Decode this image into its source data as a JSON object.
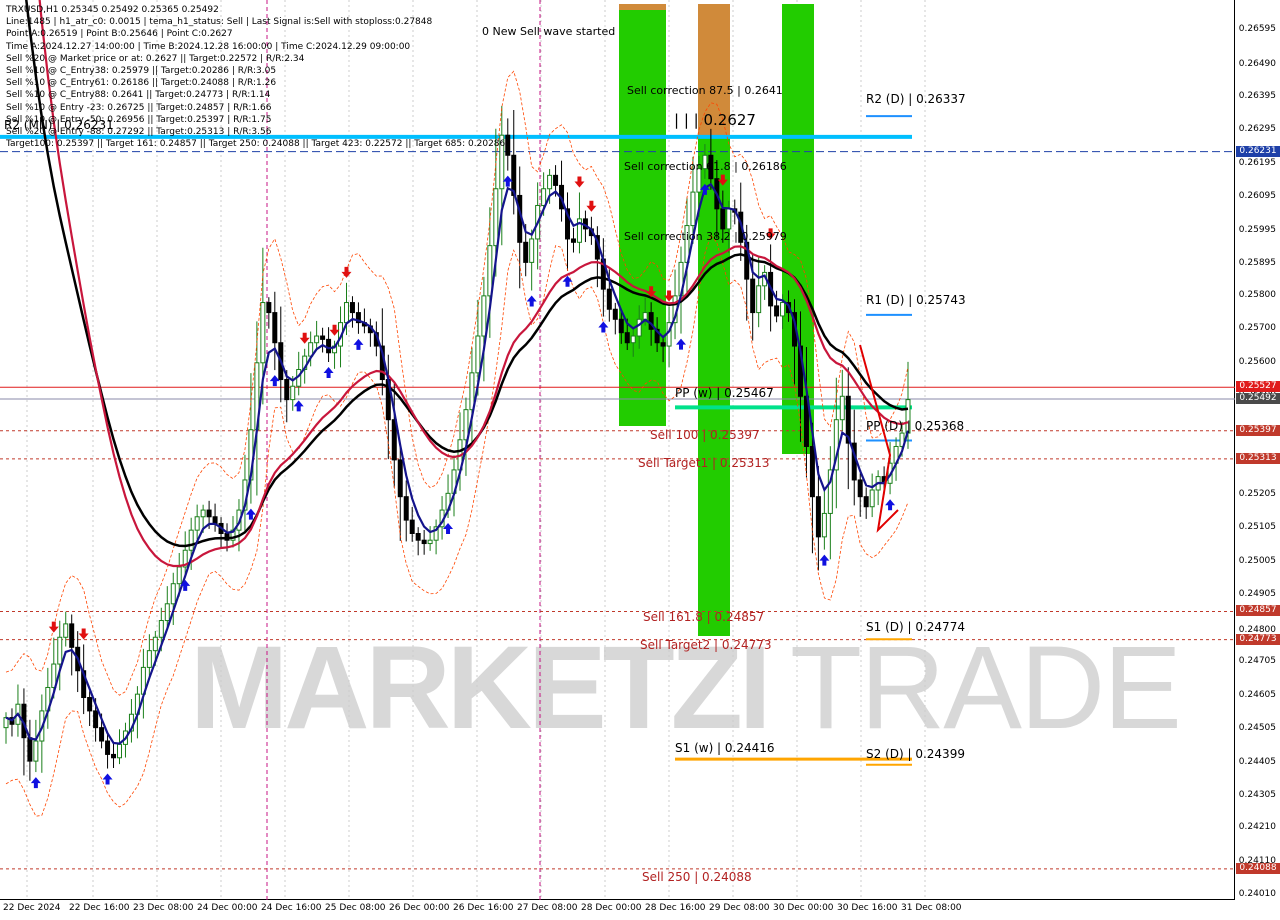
{
  "info_lines": [
    "TRXUSD,H1  0.25345 0.25492 0.25365 0.25492",
    "Line:1485 | h1_atr_c0: 0.0015 | tema_h1_status: Sell | Last Signal is:Sell with stoploss:0.27848",
    "Point A:0.26519 | Point B:0.25646 | Point C:0.2627",
    "Time A:2024.12.27 14:00:00 | Time B:2024.12.28 16:00:00 | Time C:2024.12.29 09:00:00",
    "Sell %20 @ Market price or at: 0.2627 || Target:0.22572 | R/R:2.34",
    "Sell %10 @ C_Entry38: 0.25979 || Target:0.20286 | R/R:3.05",
    "Sell %10 @ C_Entry61: 0.26186 || Target:0.24088 | R/R:1.26",
    "Sell %10 @ C_Entry88: 0.2641 || Target:0.24773 | R/R:1.14",
    "Sell %10 @ Entry -23: 0.26725 || Target:0.24857 | R/R:1.66",
    "Sell %10 @ Entry -50: 0.26956 || Target:0.25397 | R/R:1.75",
    "Sell %20 @ Entry -88: 0.27292 || Target:0.25313 | R/R:3.56",
    "Target100: 0.25397 || Target 161: 0.24857 || Target 250: 0.24088 || Target 423: 0.22572 || Target 685: 0.20286"
  ],
  "watermark": {
    "left": "MARKETZI",
    "right": "TRADE"
  },
  "signal_text": "0 New Sell wave started",
  "point_c_label": "| | | 0.2627",
  "r2_mn_label": "R2 (MN) | 0.26231",
  "level_labels": {
    "r2": "R2 (D) | 0.26337",
    "r1": "R1 (D) | 0.25743",
    "pp_w": "PP (w) | 0.25467",
    "pp_d": "PP (D) | 0.25368",
    "s1_d": "S1 (D) | 0.24774",
    "s1_w": "S1 (w) | 0.24416",
    "s2_d": "S2 (D) | 0.24399",
    "sell_100": "Sell 100 | 0.25397",
    "sell_target1": "Sell Target1 | 0.25313",
    "sell_161": "Sell 161.8 | 0.24857",
    "sell_target2": "Sell Target2 | 0.24773",
    "sell_250": "Sell 250 | 0.24088",
    "corr_875": "Sell correction 87.5 | 0.2641",
    "corr_618": "Sell correction 61.8 | 0.26186",
    "corr_382": "Sell correction 38.2 | 0.25979"
  },
  "price_badges": [
    {
      "text": "0.26231",
      "color": "#1e40a8",
      "price": 0.26231
    },
    {
      "text": "0.25527",
      "color": "#e01b1b",
      "price": 0.25527
    },
    {
      "text": "0.25492",
      "color": "#4a4a4a",
      "price": 0.25492
    },
    {
      "text": "0.25397",
      "color": "#c0392b",
      "price": 0.25397
    },
    {
      "text": "0.25313",
      "color": "#c0392b",
      "price": 0.25313
    },
    {
      "text": "0.24857",
      "color": "#c0392b",
      "price": 0.24857
    },
    {
      "text": "0.24773",
      "color": "#c0392b",
      "price": 0.24773
    },
    {
      "text": "0.24088",
      "color": "#c0392b",
      "price": 0.24088
    }
  ],
  "colors": {
    "bull": "#1a7f1a",
    "bear": "#000000",
    "tema": "#14148c",
    "sma200": "#000000",
    "sma_red": "#c8163c",
    "envelope": "#ff4500",
    "green_zone": "#22cc00",
    "orange_zone": "#d08a3a",
    "cyan_line": "#00bfff",
    "pp_w_line": "#00e28a",
    "s_orange": "#ffa500",
    "r_level": "#1e90ff"
  },
  "chart_data": {
    "type": "candlestick",
    "symbol": "TRXUSD",
    "timeframe": "H1",
    "ohlc_last": {
      "open": 0.25345,
      "high": 0.25492,
      "low": 0.25365,
      "close": 0.25492
    },
    "ylim": [
      0.2401,
      0.2666
    ],
    "y_ticks": [
      "0.26595",
      "0.26490",
      "0.26395",
      "0.26295",
      "0.26195",
      "0.26095",
      "0.25995",
      "0.25895",
      "0.25800",
      "0.25700",
      "0.25600",
      "0.25500",
      "0.25395",
      "0.25300",
      "0.25205",
      "0.25105",
      "0.25005",
      "0.24905",
      "0.24800",
      "0.24705",
      "0.24605",
      "0.24505",
      "0.24405",
      "0.24305",
      "0.24210",
      "0.24110",
      "0.24010"
    ],
    "x_ticks": [
      "22 Dec 2024",
      "22 Dec 16:00",
      "23 Dec 08:00",
      "24 Dec 00:00",
      "24 Dec 16:00",
      "25 Dec 08:00",
      "26 Dec 00:00",
      "26 Dec 16:00",
      "27 Dec 08:00",
      "28 Dec 00:00",
      "28 Dec 16:00",
      "29 Dec 08:00",
      "30 Dec 00:00",
      "30 Dec 16:00",
      "31 Dec 08:00"
    ],
    "closes": [
      0.2454,
      0.2452,
      0.2458,
      0.2448,
      0.2441,
      0.2447,
      0.2456,
      0.2463,
      0.247,
      0.2478,
      0.2482,
      0.2475,
      0.2468,
      0.246,
      0.2456,
      0.2451,
      0.2447,
      0.2443,
      0.2442,
      0.2446,
      0.245,
      0.2455,
      0.2461,
      0.2469,
      0.2474,
      0.2478,
      0.2483,
      0.2488,
      0.2494,
      0.2499,
      0.2504,
      0.251,
      0.2514,
      0.2516,
      0.2514,
      0.2512,
      0.2509,
      0.2507,
      0.251,
      0.2516,
      0.2525,
      0.254,
      0.256,
      0.2578,
      0.2575,
      0.2566,
      0.2555,
      0.2549,
      0.2553,
      0.2558,
      0.2562,
      0.2566,
      0.2568,
      0.2567,
      0.2563,
      0.2565,
      0.2572,
      0.2578,
      0.2575,
      0.2572,
      0.2571,
      0.2569,
      0.2565,
      0.2555,
      0.2543,
      0.2531,
      0.252,
      0.2513,
      0.2509,
      0.2507,
      0.2506,
      0.2507,
      0.2511,
      0.2516,
      0.2521,
      0.2528,
      0.2537,
      0.2546,
      0.2557,
      0.2568,
      0.258,
      0.2595,
      0.2612,
      0.2628,
      0.2622,
      0.261,
      0.2596,
      0.259,
      0.2597,
      0.2607,
      0.2612,
      0.2616,
      0.2613,
      0.2606,
      0.2597,
      0.2596,
      0.2603,
      0.26,
      0.2598,
      0.2591,
      0.2582,
      0.2576,
      0.2573,
      0.2569,
      0.2566,
      0.2568,
      0.2573,
      0.2575,
      0.257,
      0.2566,
      0.2565,
      0.2572,
      0.258,
      0.259,
      0.2601,
      0.2611,
      0.2618,
      0.2622,
      0.2615,
      0.2606,
      0.26,
      0.2606,
      0.2605,
      0.2596,
      0.2585,
      0.2575,
      0.2583,
      0.2587,
      0.2577,
      0.2574,
      0.2578,
      0.2575,
      0.2565,
      0.255,
      0.2535,
      0.252,
      0.2508,
      0.2515,
      0.2528,
      0.2543,
      0.255,
      0.2536,
      0.2525,
      0.252,
      0.2517,
      0.2522,
      0.2526,
      0.2524,
      0.253,
      0.2535,
      0.2539,
      0.2549
    ]
  }
}
